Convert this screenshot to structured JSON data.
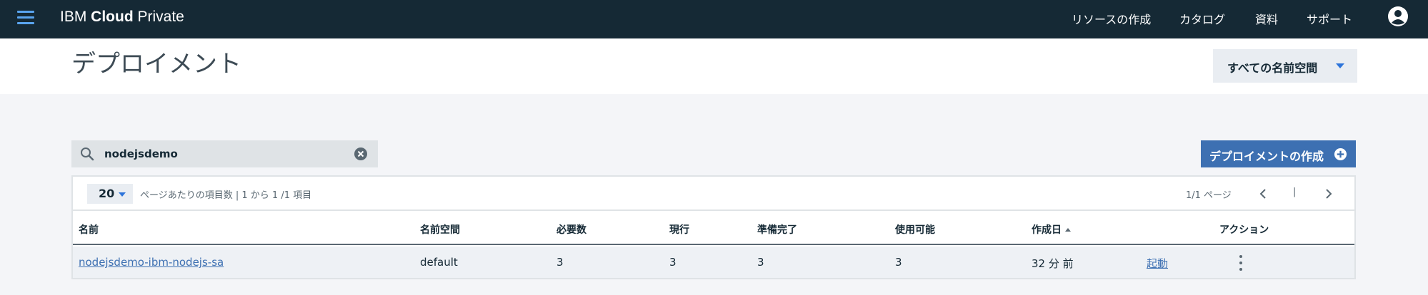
{
  "header": {
    "brand_prefix": "IBM ",
    "brand_bold": "Cloud",
    "brand_suffix": " Private",
    "nav": [
      "リソースの作成",
      "カタログ",
      "資料",
      "サポート"
    ]
  },
  "page": {
    "title": "デプロイメント",
    "namespace_dropdown": "すべての名前空間"
  },
  "search": {
    "value": "nodejsdemo"
  },
  "create_button": "デプロイメントの作成",
  "pagination": {
    "per_page": "20",
    "summary": "ページあたりの項目数 | 1 から 1 /1 項目",
    "page_count": "1/1 ページ",
    "separator": "|"
  },
  "table": {
    "columns": [
      "名前",
      "名前空間",
      "必要数",
      "現行",
      "準備完了",
      "使用可能",
      "作成日",
      "アクション"
    ],
    "rows": [
      {
        "name": "nodejsdemo-ibm-nodejs-sa",
        "namespace": "default",
        "desired": "3",
        "current": "3",
        "ready": "3",
        "available": "3",
        "created": "32 分 前",
        "launch": "起動"
      }
    ]
  },
  "colors": {
    "topbar": "#152935",
    "accent": "#3d70b2",
    "link": "#3d70b2"
  }
}
